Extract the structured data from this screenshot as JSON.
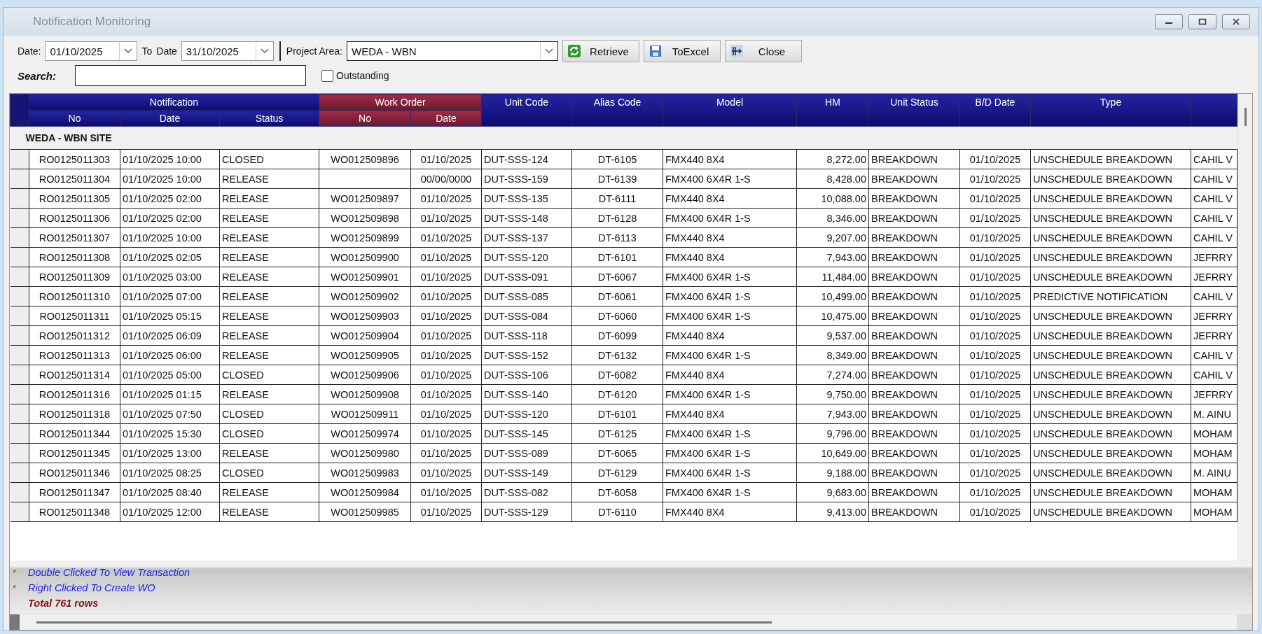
{
  "window": {
    "title": "Notification Monitoring"
  },
  "filters": {
    "date_label": "Date:",
    "date_from": "01/10/2025",
    "to_label": "To",
    "date_label_2": "Date",
    "date_to": "31/10/2025",
    "project_label": "Project Area:",
    "project_area": "WEDA - WBN"
  },
  "buttons": [
    {
      "label": "Retrieve",
      "kind": "retrieve"
    },
    {
      "label": "ToExcel",
      "kind": "excel"
    },
    {
      "label": "Close",
      "kind": "close"
    }
  ],
  "search": {
    "label": "Search:"
  },
  "outstanding": {
    "label": "Outstanding",
    "checked": false
  },
  "table": {
    "column_groups": [
      {
        "label": "Notification",
        "kind": "notification"
      },
      {
        "label": "Work Order",
        "kind": "work_order"
      }
    ],
    "columns": [
      {
        "label": "No",
        "kind": "notification"
      },
      {
        "label": "Date",
        "kind": "notification"
      },
      {
        "label": "Status",
        "kind": "notification"
      },
      {
        "label": "No",
        "kind": "work_order"
      },
      {
        "label": "Date",
        "kind": "work_order"
      },
      {
        "label": "Unit Code",
        "kind": "plain"
      },
      {
        "label": "Alias Code",
        "kind": "plain"
      },
      {
        "label": "Model",
        "kind": "plain"
      },
      {
        "label": "HM",
        "kind": "plain"
      },
      {
        "label": "Unit Status",
        "kind": "plain"
      },
      {
        "label": "B/D Date",
        "kind": "plain"
      },
      {
        "label": "Type",
        "kind": "plain"
      }
    ],
    "group_label": "WEDA - WBN SITE",
    "rows": [
      [
        "RO0125011303",
        "01/10/2025 10:00",
        "CLOSED",
        "WO012509896",
        "01/10/2025",
        "DUT-SSS-124",
        "DT-6105",
        "FMX440 8X4",
        "8,272.00",
        "BREAKDOWN",
        "01/10/2025",
        "UNSCHEDULE BREAKDOWN",
        "CAHIL V"
      ],
      [
        "RO0125011304",
        "01/10/2025 10:00",
        "RELEASE",
        null,
        "00/00/0000",
        "DUT-SSS-159",
        "DT-6139",
        "FMX400 6X4R 1-S",
        "8,428.00",
        "BREAKDOWN",
        "01/10/2025",
        "UNSCHEDULE BREAKDOWN",
        "CAHIL V"
      ],
      [
        "RO0125011305",
        "01/10/2025 02:00",
        "RELEASE",
        "WO012509897",
        "01/10/2025",
        "DUT-SSS-135",
        "DT-6111",
        "FMX440 8X4",
        "10,088.00",
        "BREAKDOWN",
        "01/10/2025",
        "UNSCHEDULE BREAKDOWN",
        "CAHIL V"
      ],
      [
        "RO0125011306",
        "01/10/2025 02:00",
        "RELEASE",
        "WO012509898",
        "01/10/2025",
        "DUT-SSS-148",
        "DT-6128",
        "FMX400 6X4R 1-S",
        "8,346.00",
        "BREAKDOWN",
        "01/10/2025",
        "UNSCHEDULE BREAKDOWN",
        "CAHIL V"
      ],
      [
        "RO0125011307",
        "01/10/2025 10:00",
        "RELEASE",
        "WO012509899",
        "01/10/2025",
        "DUT-SSS-137",
        "DT-6113",
        "FMX440 8X4",
        "9,207.00",
        "BREAKDOWN",
        "01/10/2025",
        "UNSCHEDULE BREAKDOWN",
        "CAHIL V"
      ],
      [
        "RO0125011308",
        "01/10/2025 02:05",
        "RELEASE",
        "WO012509900",
        "01/10/2025",
        "DUT-SSS-120",
        "DT-6101",
        "FMX440 8X4",
        "7,943.00",
        "BREAKDOWN",
        "01/10/2025",
        "UNSCHEDULE BREAKDOWN",
        "JEFRRY"
      ],
      [
        "RO0125011309",
        "01/10/2025 03:00",
        "RELEASE",
        "WO012509901",
        "01/10/2025",
        "DUT-SSS-091",
        "DT-6067",
        "FMX400 6X4R 1-S",
        "11,484.00",
        "BREAKDOWN",
        "01/10/2025",
        "UNSCHEDULE BREAKDOWN",
        "JEFRRY"
      ],
      [
        "RO0125011310",
        "01/10/2025 07:00",
        "RELEASE",
        "WO012509902",
        "01/10/2025",
        "DUT-SSS-085",
        "DT-6061",
        "FMX400 6X4R 1-S",
        "10,499.00",
        "BREAKDOWN",
        "01/10/2025",
        "PREDICTIVE NOTIFICATION",
        "CAHIL V"
      ],
      [
        "RO0125011311",
        "01/10/2025 05:15",
        "RELEASE",
        "WO012509903",
        "01/10/2025",
        "DUT-SSS-084",
        "DT-6060",
        "FMX400 6X4R 1-S",
        "10,475.00",
        "BREAKDOWN",
        "01/10/2025",
        "UNSCHEDULE BREAKDOWN",
        "JEFRRY"
      ],
      [
        "RO0125011312",
        "01/10/2025 06:09",
        "RELEASE",
        "WO012509904",
        "01/10/2025",
        "DUT-SSS-118",
        "DT-6099",
        "FMX440 8X4",
        "9,537.00",
        "BREAKDOWN",
        "01/10/2025",
        "UNSCHEDULE BREAKDOWN",
        "JEFRRY"
      ],
      [
        "RO0125011313",
        "01/10/2025 06:00",
        "RELEASE",
        "WO012509905",
        "01/10/2025",
        "DUT-SSS-152",
        "DT-6132",
        "FMX400 6X4R 1-S",
        "8,349.00",
        "BREAKDOWN",
        "01/10/2025",
        "UNSCHEDULE BREAKDOWN",
        "CAHIL V"
      ],
      [
        "RO0125011314",
        "01/10/2025 05:00",
        "CLOSED",
        "WO012509906",
        "01/10/2025",
        "DUT-SSS-106",
        "DT-6082",
        "FMX440 8X4",
        "7,274.00",
        "BREAKDOWN",
        "01/10/2025",
        "UNSCHEDULE BREAKDOWN",
        "CAHIL V"
      ],
      [
        "RO0125011316",
        "01/10/2025 01:15",
        "RELEASE",
        "WO012509908",
        "01/10/2025",
        "DUT-SSS-140",
        "DT-6120",
        "FMX400 6X4R 1-S",
        "9,750.00",
        "BREAKDOWN",
        "01/10/2025",
        "UNSCHEDULE BREAKDOWN",
        "JEFRRY"
      ],
      [
        "RO0125011318",
        "01/10/2025 07:50",
        "CLOSED",
        "WO012509911",
        "01/10/2025",
        "DUT-SSS-120",
        "DT-6101",
        "FMX440 8X4",
        "7,943.00",
        "BREAKDOWN",
        "01/10/2025",
        "UNSCHEDULE BREAKDOWN",
        "M. AINU"
      ],
      [
        "RO0125011344",
        "01/10/2025 15:30",
        "CLOSED",
        "WO012509974",
        "01/10/2025",
        "DUT-SSS-145",
        "DT-6125",
        "FMX400 6X4R 1-S",
        "9,796.00",
        "BREAKDOWN",
        "01/10/2025",
        "UNSCHEDULE BREAKDOWN",
        "MOHAM"
      ],
      [
        "RO0125011345",
        "01/10/2025 13:00",
        "RELEASE",
        "WO012509980",
        "01/10/2025",
        "DUT-SSS-089",
        "DT-6065",
        "FMX400 6X4R 1-S",
        "10,649.00",
        "BREAKDOWN",
        "01/10/2025",
        "UNSCHEDULE BREAKDOWN",
        "MOHAM"
      ],
      [
        "RO0125011346",
        "01/10/2025 08:25",
        "CLOSED",
        "WO012509983",
        "01/10/2025",
        "DUT-SSS-149",
        "DT-6129",
        "FMX400 6X4R 1-S",
        "9,188.00",
        "BREAKDOWN",
        "01/10/2025",
        "UNSCHEDULE BREAKDOWN",
        "M. AINU"
      ],
      [
        "RO0125011347",
        "01/10/2025 08:40",
        "RELEASE",
        "WO012509984",
        "01/10/2025",
        "DUT-SSS-082",
        "DT-6058",
        "FMX400 6X4R 1-S",
        "9,683.00",
        "BREAKDOWN",
        "01/10/2025",
        "UNSCHEDULE BREAKDOWN",
        "MOHAM"
      ],
      [
        "RO0125011348",
        "01/10/2025 12:00",
        "RELEASE",
        "WO012509985",
        "01/10/2025",
        "DUT-SSS-129",
        "DT-6110",
        "FMX440 8X4",
        "9,413.00",
        "BREAKDOWN",
        "01/10/2025",
        "UNSCHEDULE BREAKDOWN",
        "MOHAM"
      ]
    ]
  },
  "notes": [
    {
      "mark": "*",
      "text": "Double Clicked To View Transaction"
    },
    {
      "mark": "*",
      "text": "Right Clicked To Create WO"
    }
  ],
  "total": "Total 761 rows"
}
